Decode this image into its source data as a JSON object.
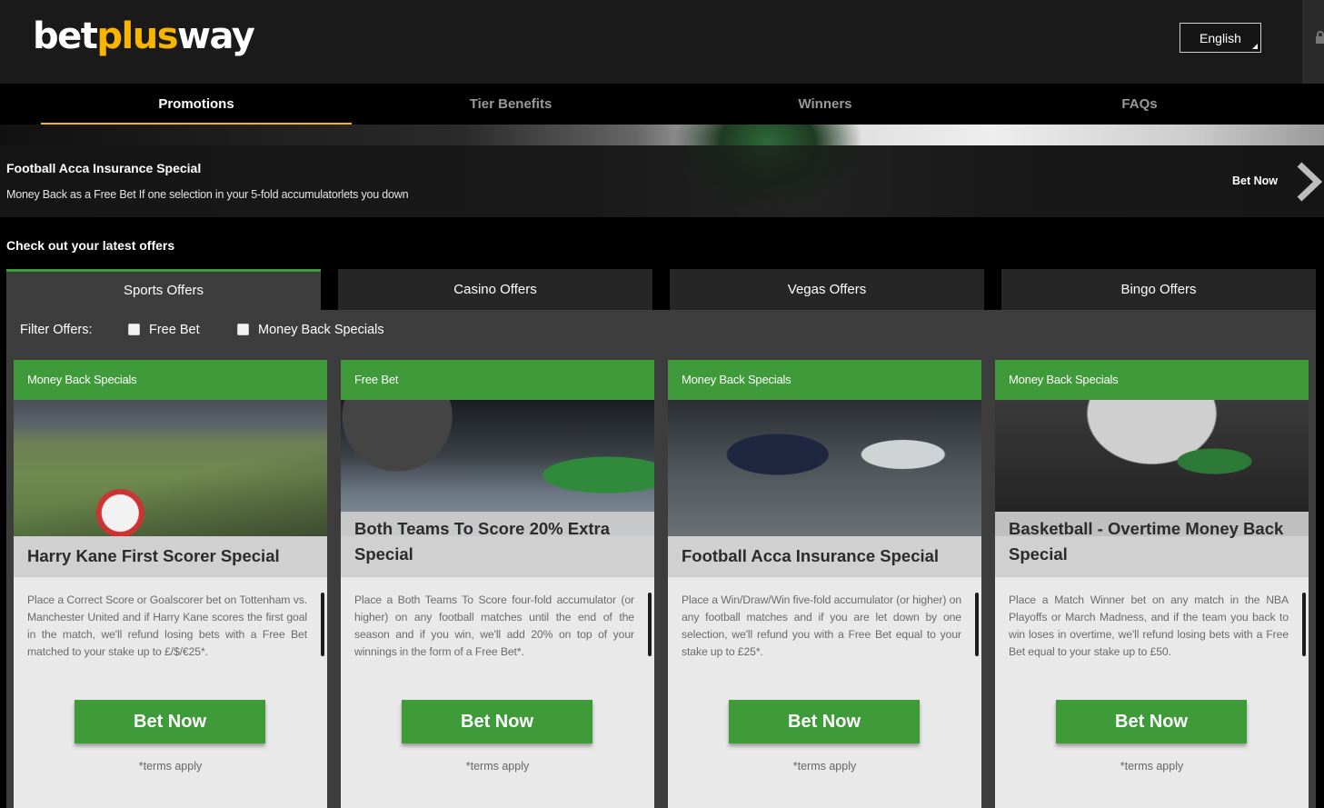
{
  "brand": {
    "logo_part1": "bet",
    "logo_part2": "plus",
    "logo_part3": "way"
  },
  "header": {
    "language": "English"
  },
  "nav": {
    "items": [
      {
        "label": "Promotions",
        "active": true
      },
      {
        "label": "Tier Benefits",
        "active": false
      },
      {
        "label": "Winners",
        "active": false
      },
      {
        "label": "FAQs",
        "active": false
      }
    ]
  },
  "banner": {
    "title": "Football Acca Insurance Special",
    "subtitle": "Money Back as a Free Bet If one selection in your 5-fold accumulatorlets you down",
    "cta": "Bet Now"
  },
  "offers": {
    "heading": "Check out your latest offers",
    "tabs": [
      {
        "label": "Sports Offers",
        "active": true
      },
      {
        "label": "Casino Offers",
        "active": false
      },
      {
        "label": "Vegas Offers",
        "active": false
      },
      {
        "label": "Bingo Offers",
        "active": false
      }
    ],
    "filter": {
      "label": "Filter Offers:",
      "options": [
        {
          "label": "Free Bet",
          "checked": false
        },
        {
          "label": "Money Back Specials",
          "checked": false
        }
      ]
    },
    "cards": [
      {
        "tag": "Money Back Specials",
        "title": "Harry Kane First Scorer Special",
        "description": "Place a Correct Score or Goalscorer bet on Tottenham vs. Manchester United and if Harry Kane scores the first goal in the match, we'll refund losing bets with a Free Bet matched to your stake up to £/$/€25*.",
        "button": "Bet Now",
        "terms": "*terms apply"
      },
      {
        "tag": "Free Bet",
        "title": "Both Teams To Score 20% Extra Special",
        "description": "Place a Both Teams To Score four-fold accumulator (or higher) on any football matches until the end of the season and if you win, we'll add 20% on top of your winnings in the form of a Free Bet*.",
        "button": "Bet Now",
        "terms": "*terms apply"
      },
      {
        "tag": "Money Back Specials",
        "title": "Football Acca Insurance Special",
        "description": "Place a Win/Draw/Win five-fold accumulator (or higher) on any football matches and if you are let down by one selection, we'll refund you with a Free Bet equal to your stake up to £25*.",
        "button": "Bet Now",
        "terms": "*terms apply"
      },
      {
        "tag": "Money Back Specials",
        "title": "Basketball - Overtime Money Back Special",
        "description": "Place a Match Winner bet on any match in the NBA Playoffs or March Madness, and if the team you back to win loses in overtime, we'll refund losing bets with a Free Bet equal to your stake up to £50.",
        "button": "Bet Now",
        "terms": "*terms apply"
      }
    ]
  },
  "colors": {
    "accent_green": "#3f9a3a",
    "brand_yellow": "#f7b500",
    "background": "#000000",
    "panel": "#3d3d3d"
  }
}
